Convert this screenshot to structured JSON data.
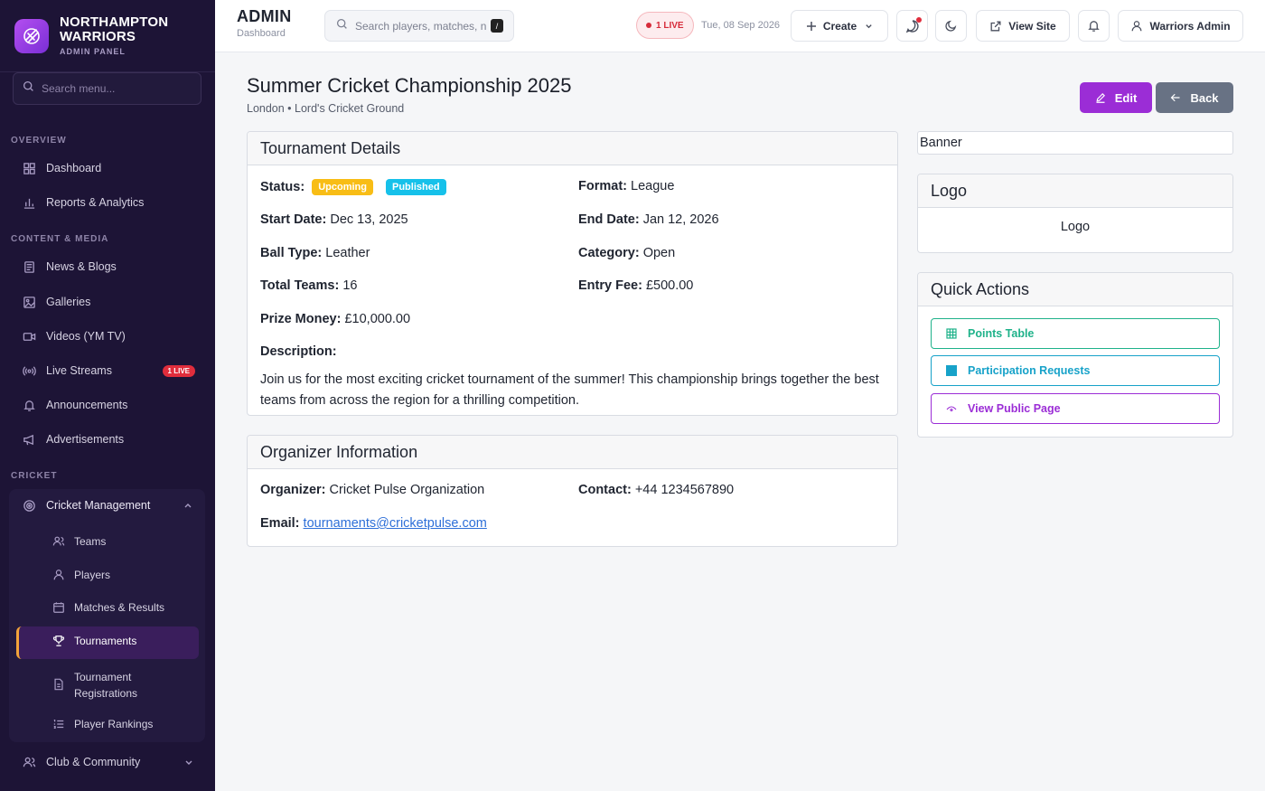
{
  "brand": {
    "name_line1": "NORTHAMPTON",
    "name_line2": "WARRIORS",
    "subtitle": "ADMIN PANEL"
  },
  "sidebar": {
    "search_placeholder": "Search menu...",
    "sections": {
      "overview": "OVERVIEW",
      "content": "CONTENT & MEDIA",
      "cricket": "CRICKET"
    },
    "items": {
      "dashboard": "Dashboard",
      "reports": "Reports & Analytics",
      "news": "News & Blogs",
      "galleries": "Galleries",
      "videos": "Videos (YM TV)",
      "live_streams": "Live Streams",
      "live_badge": "1 LIVE",
      "announcements": "Announcements",
      "advertisements": "Advertisements",
      "cricket_management": "Cricket Management",
      "club_community": "Club & Community"
    },
    "sub_items": {
      "teams": "Teams",
      "players": "Players",
      "matches": "Matches & Results",
      "tournaments": "Tournaments",
      "registrations_1": "Tournament",
      "registrations_2": "Registrations",
      "rankings": "Player Rankings"
    }
  },
  "topbar": {
    "title": "ADMIN",
    "subtitle": "Dashboard",
    "search_placeholder": "Search players, matches, n",
    "search_kbd": "/",
    "live": "1 LIVE",
    "date": "Tue, 08 Sep 2026",
    "create": "Create",
    "view_site": "View Site",
    "user": "Warriors Admin"
  },
  "page": {
    "title": "Summer Cricket Championship 2025",
    "subtitle": "London • Lord's Cricket Ground",
    "edit": "Edit",
    "back": "Back"
  },
  "details": {
    "heading": "Tournament Details",
    "status_label": "Status:",
    "status_tag1": "Upcoming",
    "status_tag2": "Published",
    "format_label": "Format:",
    "format": "League",
    "start_label": "Start Date:",
    "start": "Dec 13, 2025",
    "end_label": "End Date:",
    "end": "Jan 12, 2026",
    "ball_label": "Ball Type:",
    "ball": "Leather",
    "category_label": "Category:",
    "category": "Open",
    "teams_label": "Total Teams:",
    "teams": "16",
    "fee_label": "Entry Fee:",
    "fee": "£500.00",
    "prize_label": "Prize Money:",
    "prize": "£10,000.00",
    "desc_label": "Description:",
    "desc": "Join us for the most exciting cricket tournament of the summer! This championship brings together the best teams from across the region for a thrilling competition."
  },
  "organizer": {
    "heading": "Organizer Information",
    "name_label": "Organizer:",
    "name": "Cricket Pulse Organization",
    "contact_label": "Contact:",
    "contact": "+44 1234567890",
    "email_label": "Email:",
    "email": "tournaments@cricketpulse.com"
  },
  "banner": {
    "alt": "Banner"
  },
  "logo_card": {
    "heading": "Logo",
    "alt": "Logo"
  },
  "quick_actions": {
    "heading": "Quick Actions",
    "points_table": "Points Table",
    "participation": "Participation Requests",
    "public_page": "View Public Page"
  }
}
